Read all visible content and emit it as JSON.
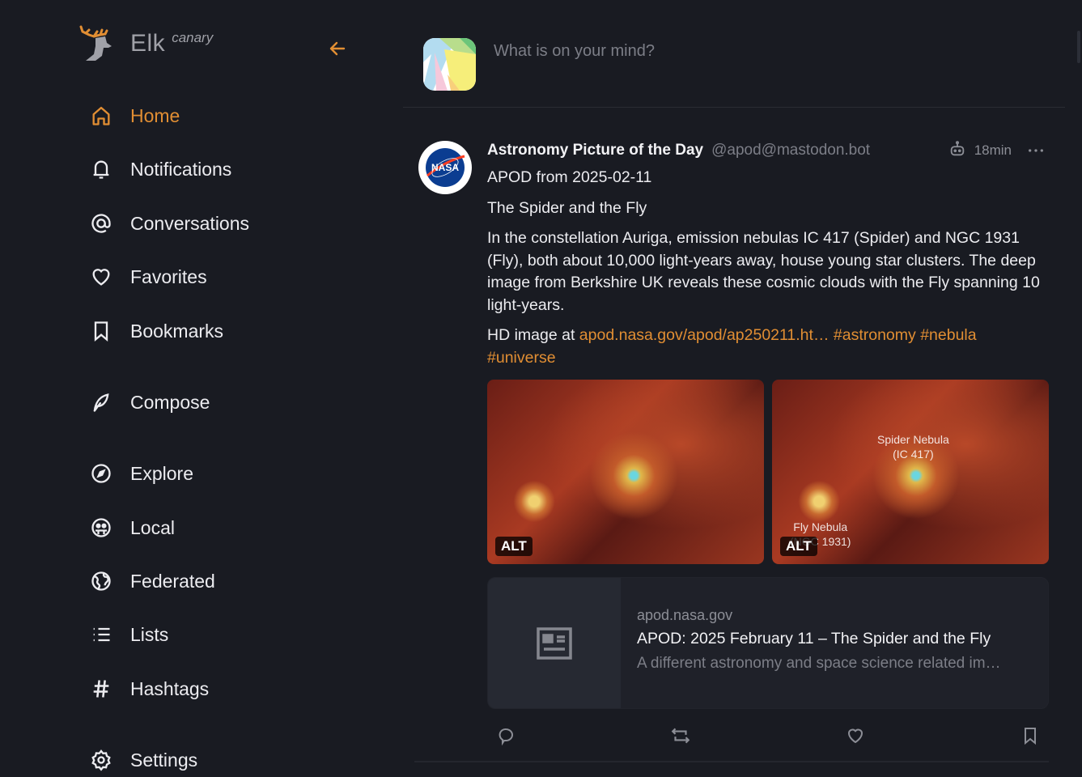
{
  "app": {
    "brand": "Elk",
    "channel": "canary",
    "accent_color": "#e18e33"
  },
  "sidebar": {
    "back_icon": "arrow-left-icon",
    "items": [
      {
        "label": "Home",
        "icon": "home-icon",
        "active": true
      },
      {
        "label": "Notifications",
        "icon": "bell-icon"
      },
      {
        "label": "Conversations",
        "icon": "at-icon"
      },
      {
        "label": "Favorites",
        "icon": "heart-icon"
      },
      {
        "label": "Bookmarks",
        "icon": "bookmark-icon"
      },
      {
        "label": "Compose",
        "icon": "feather-icon"
      },
      {
        "label": "Explore",
        "icon": "compass-icon"
      },
      {
        "label": "Local",
        "icon": "group-icon"
      },
      {
        "label": "Federated",
        "icon": "globe-icon"
      },
      {
        "label": "Lists",
        "icon": "list-icon"
      },
      {
        "label": "Hashtags",
        "icon": "hashtag-icon"
      },
      {
        "label": "Settings",
        "icon": "gear-icon"
      }
    ]
  },
  "composer": {
    "placeholder": "What is on your mind?"
  },
  "status": {
    "display_name": "Astronomy Picture of the Day",
    "handle": "@apod@mastodon.bot",
    "bot_icon": "robot-icon",
    "time": "18min",
    "more_icon": "more-horizontal-icon",
    "avatar_text": "NASA",
    "content": {
      "line1": "APOD from 2025-02-11",
      "line2": "The Spider and the Fly",
      "line3": "In the constellation Auriga, emission nebulas IC 417 (Spider) and NGC 1931 (Fly), both about 10,000 light-years away, house young star clusters. The deep image from Berkshire UK reveals these cosmic clouds with the Fly spanning 10 light-years.",
      "hd_prefix": "HD image at ",
      "link": "apod.nasa.gov/apod/ap250211.ht…",
      "hashtags": [
        "#astronomy",
        "#nebula",
        "#universe"
      ]
    },
    "media": [
      {
        "alt_badge": "ALT",
        "labels": []
      },
      {
        "alt_badge": "ALT",
        "labels": [
          "Spider Nebula",
          "(IC 417)",
          "Fly Nebula",
          "(NGC 1931)"
        ]
      }
    ],
    "card": {
      "domain": "apod.nasa.gov",
      "title": "APOD: 2025 February 11 – The Spider and the Fly",
      "description": "A different astronomy and space science related im…",
      "thumb_icon": "article-icon"
    },
    "actions": [
      {
        "name": "reply",
        "icon": "comment-icon"
      },
      {
        "name": "boost",
        "icon": "repeat-icon"
      },
      {
        "name": "favorite",
        "icon": "heart-icon"
      },
      {
        "name": "bookmark",
        "icon": "bookmark-icon"
      }
    ]
  }
}
